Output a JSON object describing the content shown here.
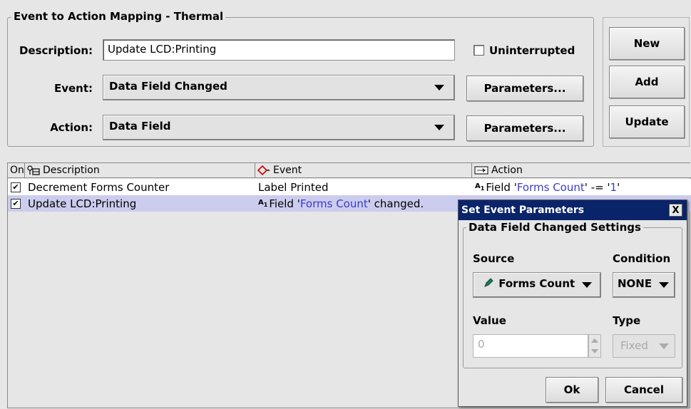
{
  "group": {
    "title": "Event to Action Mapping - Thermal"
  },
  "description": {
    "label": "Description:",
    "value": "Update LCD:Printing"
  },
  "uninterrupted": {
    "label": "Uninterrupted"
  },
  "event": {
    "label": "Event:",
    "value": "Data Field Changed",
    "params_label": "Parameters..."
  },
  "action": {
    "label": "Action:",
    "value": "Data Field",
    "params_label": "Parameters..."
  },
  "buttons": {
    "new": "New",
    "add": "Add",
    "update": "Update"
  },
  "table": {
    "headers": {
      "on": "On",
      "description": "Description",
      "event": "Event",
      "action": "Action"
    },
    "rows": [
      {
        "checked": "✔",
        "description": "Decrement Forms Counter",
        "event_plain": "Label Printed",
        "action_prefix": "Field '",
        "action_field": "Forms Count",
        "action_mid": "' -= '",
        "action_value": "1",
        "action_suffix": "'"
      },
      {
        "checked": "✔",
        "description": "Update LCD:Printing",
        "event_prefix": "Field '",
        "event_field": "Forms Count",
        "event_suffix": "' changed."
      }
    ]
  },
  "dialog": {
    "title": "Set Event Parameters",
    "close": "X",
    "group_title": "Data Field Changed Settings",
    "source_label": "Source",
    "condition_label": "Condition",
    "source_value": "Forms Count",
    "condition_value": "NONE",
    "value_label": "Value",
    "type_label": "Type",
    "value_field": "0",
    "type_value": "Fixed",
    "ok": "Ok",
    "cancel": "Cancel"
  }
}
